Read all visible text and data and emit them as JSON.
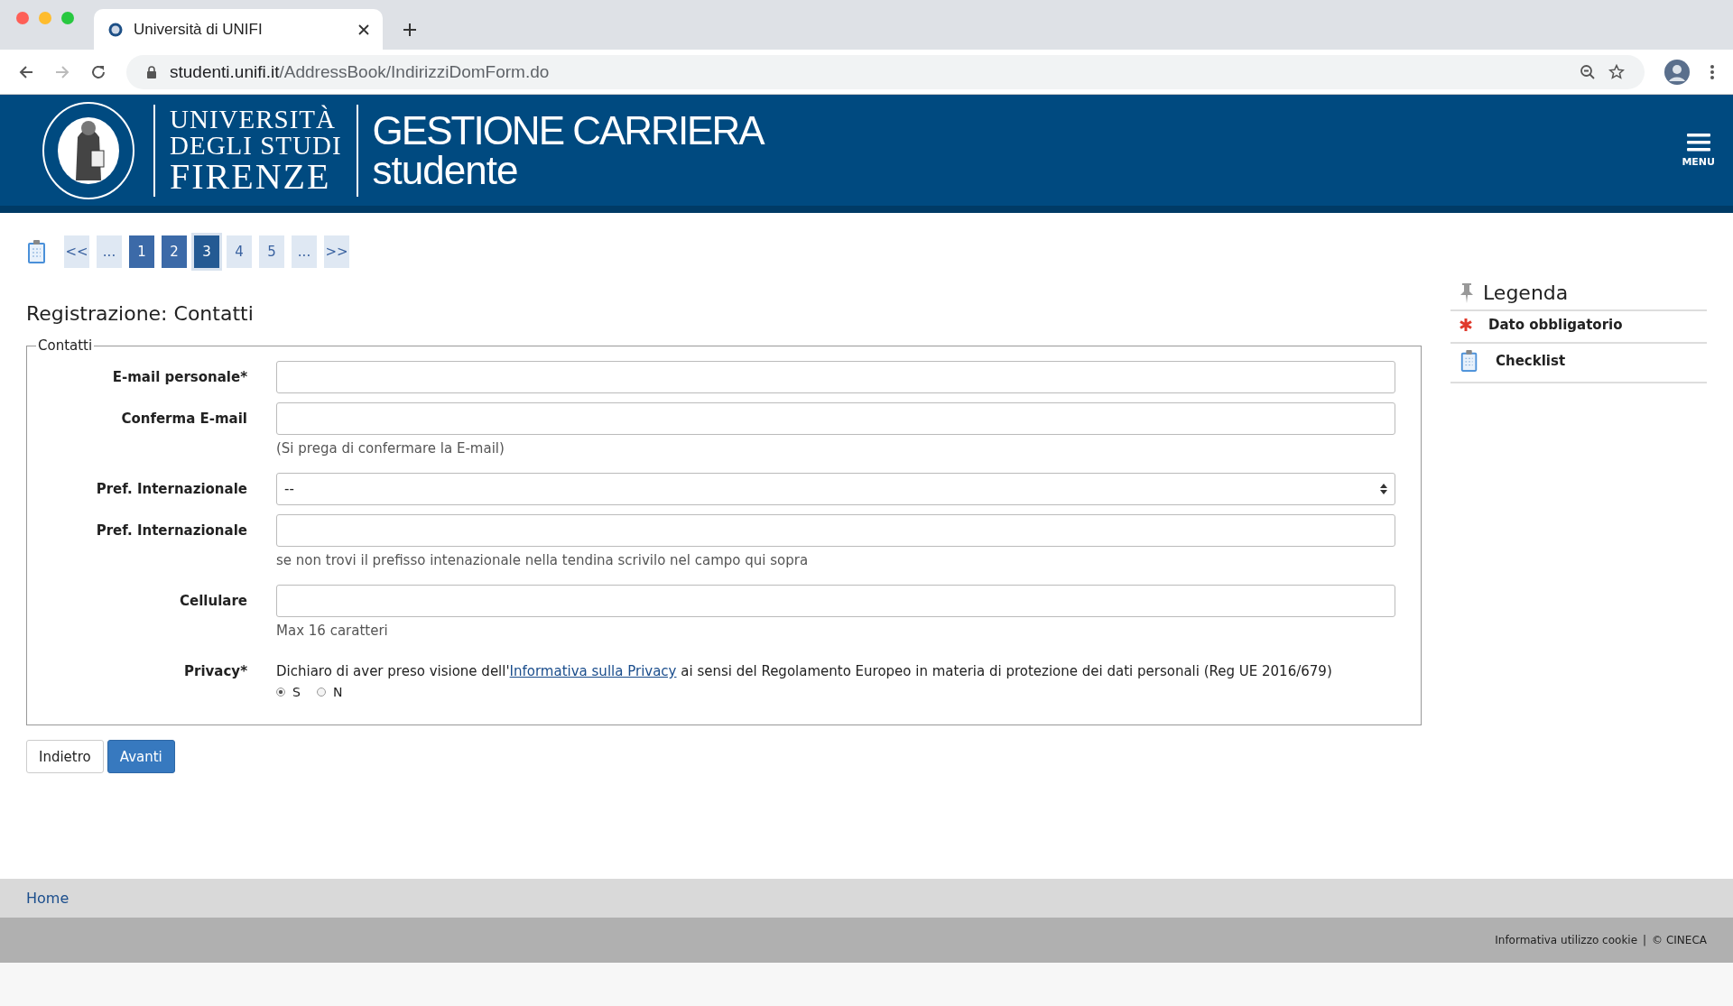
{
  "browser": {
    "tab_title": "Università di UNIFI",
    "url_domain": "studenti.unifi.it",
    "url_path": "/AddressBook/IndirizziDomForm.do"
  },
  "header": {
    "logo_lines": [
      "UNIVERSITÀ",
      "DEGLI STUDI",
      "FIRENZE"
    ],
    "title": "GESTIONE CARRIERA",
    "subtitle": "studente",
    "menu_label": "MENU"
  },
  "pager": [
    {
      "label": "<<",
      "kind": "plain"
    },
    {
      "label": "...",
      "kind": "plain"
    },
    {
      "label": "1",
      "kind": "done"
    },
    {
      "label": "2",
      "kind": "done"
    },
    {
      "label": "3",
      "kind": "current"
    },
    {
      "label": "4",
      "kind": "plain"
    },
    {
      "label": "5",
      "kind": "plain"
    },
    {
      "label": "...",
      "kind": "plain"
    },
    {
      "label": ">>",
      "kind": "plain"
    }
  ],
  "page_title": "Registrazione: Contatti",
  "fieldset": {
    "legend": "Contatti",
    "fields": [
      {
        "label": "E-mail personale*",
        "kind": "text"
      },
      {
        "label": "Conferma E-mail",
        "kind": "text",
        "hint": "(Si prega di confermare la E-mail)"
      },
      {
        "label": "Pref. Internazionale",
        "kind": "select",
        "value": "--"
      },
      {
        "label": "Pref. Internazionale",
        "kind": "text",
        "hint": "se non trovi il prefisso intenazionale nella tendina scrivilo nel campo qui sopra"
      },
      {
        "label": "Cellulare",
        "kind": "text",
        "hint": "Max 16 caratteri"
      },
      {
        "label": "Privacy*",
        "kind": "privacy",
        "text_before": "Dichiaro di aver preso visione dell'",
        "link": "Informativa sulla Privacy",
        "text_after": " ai sensi del Regolamento Europeo in materia di protezione dei dati personali (Reg UE 2016/679)",
        "options": [
          {
            "label": "S",
            "selected": true
          },
          {
            "label": "N",
            "selected": false
          }
        ]
      }
    ]
  },
  "buttons": [
    {
      "label": "Indietro",
      "kind": "secondary"
    },
    {
      "label": "Avanti",
      "kind": "primary"
    }
  ],
  "legend": {
    "title": "Legenda",
    "items": [
      {
        "label": "Dato obbligatorio",
        "kind": "required"
      },
      {
        "label": "Checklist",
        "kind": "checklist"
      }
    ]
  },
  "footer": {
    "home": "Home",
    "cookie": "Informativa utilizzo cookie",
    "separator": "|",
    "copyright": "© CINECA"
  }
}
